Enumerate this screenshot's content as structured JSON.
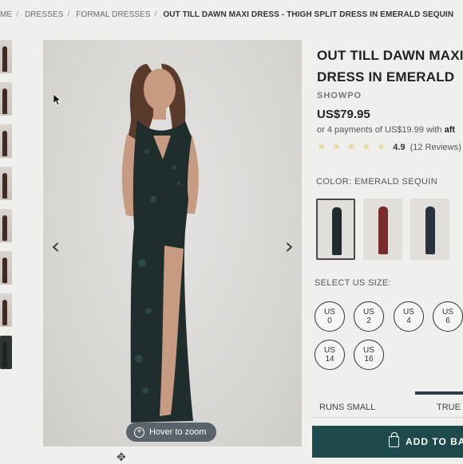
{
  "breadcrumb": {
    "items": [
      "ME",
      "DRESSES",
      "FORMAL DRESSES"
    ],
    "current": "OUT TILL DAWN MAXI DRESS - THIGH SPLIT DRESS IN EMERALD SEQUIN"
  },
  "gallery": {
    "prev_icon": "chevron-left-icon",
    "next_icon": "chevron-right-icon",
    "zoom_hint": "Hover to zoom",
    "thumbnail_count": 8
  },
  "product": {
    "title_line1": "OUT TILL DAWN MAXI",
    "title_line2": "DRESS IN EMERALD",
    "brand": "SHOWPO",
    "price": "US$79.95",
    "installments_prefix": "or 4 payments of US$19.99 with",
    "installments_provider": "aft",
    "rating_value": "4.9",
    "rating_stars": 5,
    "reviews": "(12 Reviews)"
  },
  "color": {
    "label": "COLOR: EMERALD SEQUIN",
    "swatches": [
      {
        "name": "emerald",
        "color": "#1f2e2c",
        "selected": true
      },
      {
        "name": "burgundy",
        "color": "#7a2b2b",
        "selected": false
      },
      {
        "name": "navy",
        "color": "#2a3140",
        "selected": false
      }
    ]
  },
  "size": {
    "label": "SELECT US SIZE:",
    "options": [
      {
        "prefix": "US",
        "value": "0"
      },
      {
        "prefix": "US",
        "value": "2"
      },
      {
        "prefix": "US",
        "value": "4"
      },
      {
        "prefix": "US",
        "value": "6"
      },
      {
        "prefix": "US",
        "value": "14"
      },
      {
        "prefix": "US",
        "value": "16"
      }
    ]
  },
  "fit": {
    "left": "RUNS SMALL",
    "right": "TRUE T"
  },
  "cart": {
    "label": "ADD TO BA"
  },
  "colors": {
    "button": "#1e4a4b",
    "star": "#e7d99d"
  }
}
